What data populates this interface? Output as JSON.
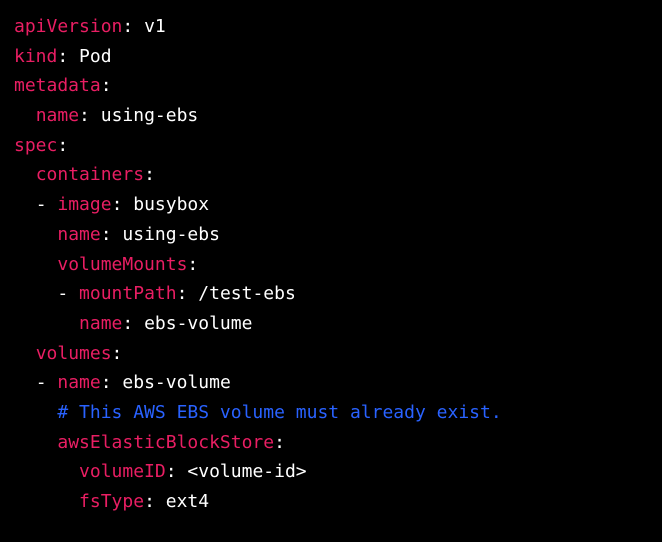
{
  "lines": [
    {
      "indent": 0,
      "type": "kv",
      "key": "apiVersion",
      "value": "v1"
    },
    {
      "indent": 0,
      "type": "kv",
      "key": "kind",
      "value": "Pod"
    },
    {
      "indent": 0,
      "type": "k",
      "key": "metadata"
    },
    {
      "indent": 1,
      "type": "kv",
      "key": "name",
      "value": "using-ebs"
    },
    {
      "indent": 0,
      "type": "k",
      "key": "spec"
    },
    {
      "indent": 1,
      "type": "k",
      "key": "containers"
    },
    {
      "indent": 1,
      "type": "dash-kv",
      "key": "image",
      "value": "busybox"
    },
    {
      "indent": 2,
      "type": "kv",
      "key": "name",
      "value": "using-ebs"
    },
    {
      "indent": 2,
      "type": "k",
      "key": "volumeMounts"
    },
    {
      "indent": 2,
      "type": "dash-kv",
      "key": "mountPath",
      "value": "/test-ebs"
    },
    {
      "indent": 3,
      "type": "kv",
      "key": "name",
      "value": "ebs-volume"
    },
    {
      "indent": 1,
      "type": "k",
      "key": "volumes"
    },
    {
      "indent": 1,
      "type": "dash-kv",
      "key": "name",
      "value": "ebs-volume"
    },
    {
      "indent": 2,
      "type": "comment",
      "text": "# This AWS EBS volume must already exist."
    },
    {
      "indent": 2,
      "type": "k",
      "key": "awsElasticBlockStore"
    },
    {
      "indent": 3,
      "type": "kv",
      "key": "volumeID",
      "value": "<volume-id>"
    },
    {
      "indent": 3,
      "type": "kv",
      "key": "fsType",
      "value": "ext4"
    }
  ]
}
